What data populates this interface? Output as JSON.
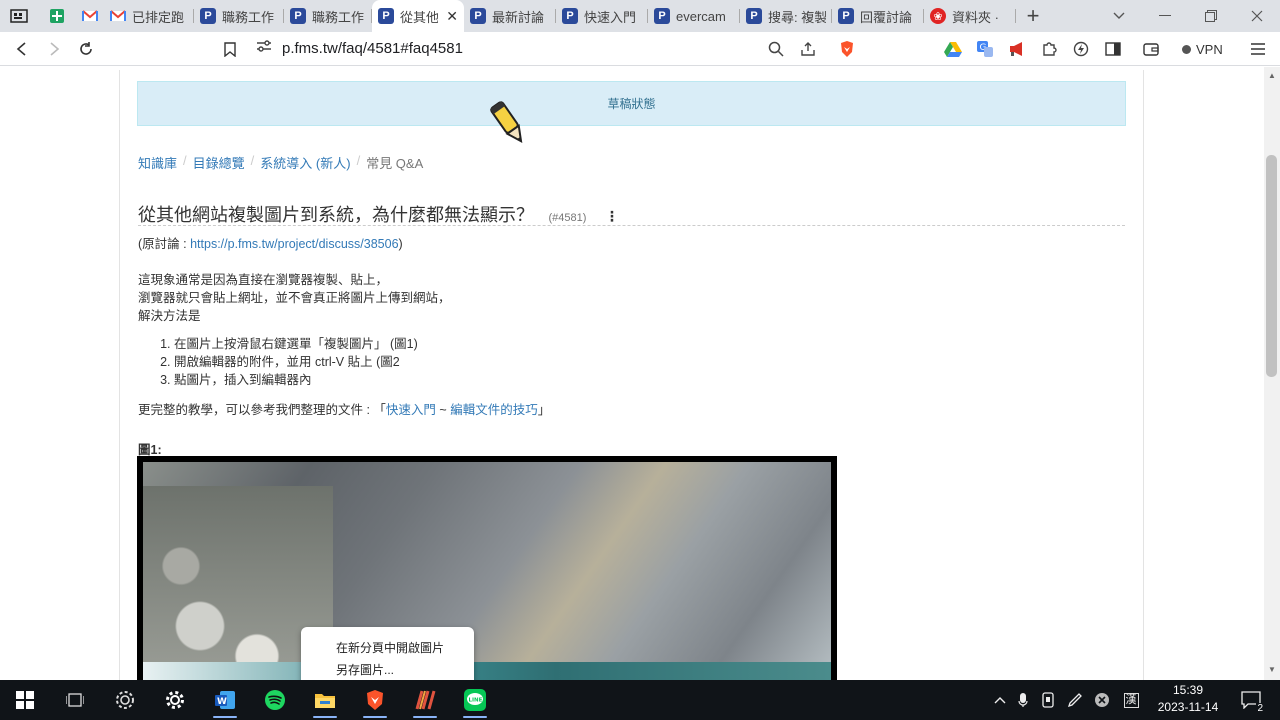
{
  "tabs": [
    {
      "label": "已排定跑",
      "kind": "gmail"
    },
    {
      "label": "職務工作",
      "kind": "p"
    },
    {
      "label": "職務工作",
      "kind": "p"
    },
    {
      "label": "從其他",
      "kind": "p",
      "active": true
    },
    {
      "label": "最新討論",
      "kind": "p"
    },
    {
      "label": "快速入門",
      "kind": "p"
    },
    {
      "label": "evercam",
      "kind": "p"
    },
    {
      "label": "搜尋: 複製",
      "kind": "p"
    },
    {
      "label": "回覆討論",
      "kind": "p"
    },
    {
      "label": "資料夾 ·",
      "kind": "red"
    }
  ],
  "tab_add": "+",
  "address": {
    "url": "p.fms.tw/faq/4581#faq4581"
  },
  "vpn_label": "VPN",
  "page": {
    "draft_label": "草稿狀態",
    "breadcrumb": [
      "知識庫",
      "目錄總覽",
      "系統導入 (新人)",
      "常見 Q&A"
    ],
    "title": "從其他網站複製圖片到系統，為什麼都無法顯示？",
    "faq_number": "(#4581)",
    "source_prefix": "(原討論 : ",
    "source_link": "https://p.fms.tw/project/discuss/38506",
    "source_suffix": ")",
    "para_lines": [
      "這現象通常是因為直接在瀏覽器複製、貼上，",
      "瀏覽器就只會貼上網址，並不會真正將圖片上傳到網站，",
      "解決方法是"
    ],
    "steps": [
      "在圖片上按滑鼠右鍵選單「複製圖片」 (圖1)",
      "開啟編輯器的附件，並用 ctrl-V 貼上 (圖2",
      "點圖片，插入到編輯器內"
    ],
    "more_prefix": "更完整的教學，可以參考我們整理的文件 : 「",
    "more_link1": "快速入門",
    "more_sep": " ~ ",
    "more_link2": "編輯文件的技巧",
    "more_suffix": "」",
    "figure_label": "圖1:",
    "context_menu": [
      "在新分頁中開啟圖片",
      "另存圖片..."
    ]
  },
  "taskbar": {
    "time": "15:39",
    "date": "2023-11-14",
    "ime": "漢",
    "notif_count": "2"
  },
  "colors": {
    "link": "#337ab7",
    "draft_bg": "#d9edf7",
    "draft_text": "#31708f",
    "tab_bar": "#dee1e6",
    "taskbar": "#101418"
  }
}
